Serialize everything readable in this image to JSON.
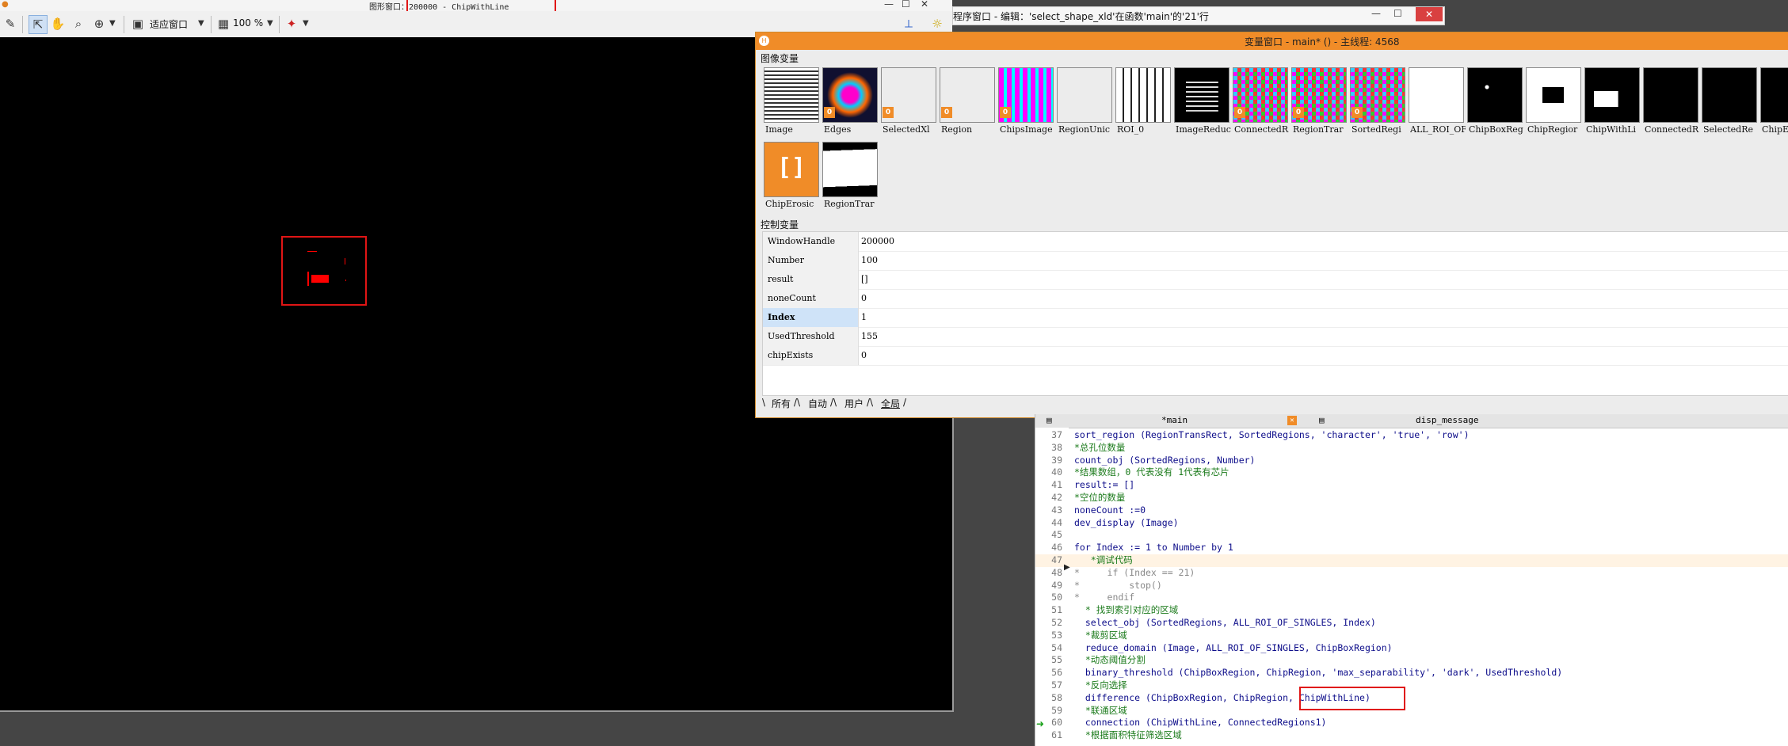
{
  "graphics_window": {
    "title": "图形窗口：200000 - ChipWithLine",
    "title_prefix": "图形窗口：",
    "title_value": "200000 - ChipWithLine",
    "toolbar": {
      "fit_label": "适应窗口",
      "zoom_label": "100 %"
    }
  },
  "editor_window": {
    "title": "程序窗口 - 编辑：'select_shape_xld'在函数'main'的'21'行"
  },
  "variable_window": {
    "title": "变量窗口 - main* () - 主线程: 4568",
    "iconic_section_label": "图像变量",
    "control_section_label": "控制变量",
    "iconic_variables": [
      {
        "name": "Image",
        "style": "chip",
        "badge": ""
      },
      {
        "name": "Edges",
        "style": "edges",
        "badge": "0"
      },
      {
        "name": "SelectedXl",
        "style": "grid-color",
        "badge": "0"
      },
      {
        "name": "Region",
        "style": "grid-color",
        "badge": "0"
      },
      {
        "name": "ChipsImage",
        "style": "grid-color2",
        "badge": "0"
      },
      {
        "name": "RegionUnic",
        "style": "grid-white",
        "badge": ""
      },
      {
        "name": "ROI_0",
        "style": "stripes",
        "badge": ""
      },
      {
        "name": "ImageReduc",
        "style": "chip-dark",
        "badge": ""
      },
      {
        "name": "ConnectedR",
        "style": "checker",
        "badge": "0"
      },
      {
        "name": "RegionTrar",
        "style": "checker",
        "badge": "0"
      },
      {
        "name": "SortedRegi",
        "style": "checker",
        "badge": "0"
      },
      {
        "name": "ALL_ROI_OF",
        "style": "white",
        "badge": ""
      },
      {
        "name": "ChipBoxReg",
        "style": "black-dot",
        "badge": ""
      },
      {
        "name": "ChipRegior",
        "style": "white-box",
        "badge": ""
      },
      {
        "name": "ChipWithLi",
        "style": "black-box",
        "badge": ""
      },
      {
        "name": "ConnectedR",
        "style": "black",
        "badge": ""
      },
      {
        "name": "SelectedRe",
        "style": "black",
        "badge": ""
      },
      {
        "name": "ChipE",
        "style": "black",
        "badge": ""
      },
      {
        "name": "ChipErosic",
        "style": "empty",
        "badge": ""
      },
      {
        "name": "RegionTrar",
        "style": "white-skew",
        "badge": ""
      }
    ],
    "empty_glyph": "[]",
    "control_variables": [
      {
        "name": "WindowHandle",
        "value": "200000"
      },
      {
        "name": "Number",
        "value": "100"
      },
      {
        "name": "result",
        "value": "[]"
      },
      {
        "name": "noneCount",
        "value": "0"
      },
      {
        "name": "Index",
        "value": "1"
      },
      {
        "name": "UsedThreshold",
        "value": "155"
      },
      {
        "name": "chipExists",
        "value": "0"
      }
    ],
    "tabs": [
      "所有",
      "自动",
      "用户",
      "全局"
    ]
  },
  "program_window": {
    "tabs": [
      "*main",
      "disp_message"
    ],
    "lines": [
      {
        "n": "37",
        "kind": "op",
        "text": "sort_region (RegionTransRect, SortedRegions, 'character', 'true', 'row')"
      },
      {
        "n": "38",
        "kind": "cm",
        "text": "*总孔位数量"
      },
      {
        "n": "39",
        "kind": "op",
        "text": "count_obj (SortedRegions, Number)"
      },
      {
        "n": "40",
        "kind": "cm",
        "text": "*结果数组，0 代表没有 1代表有芯片"
      },
      {
        "n": "41",
        "kind": "op",
        "text": "result:= []"
      },
      {
        "n": "42",
        "kind": "cm",
        "text": "*空位的数量"
      },
      {
        "n": "43",
        "kind": "op",
        "text": "noneCount :=0"
      },
      {
        "n": "44",
        "kind": "op",
        "text": "dev_display (Image)"
      },
      {
        "n": "45",
        "kind": "op",
        "text": ""
      },
      {
        "n": "46",
        "kind": "op",
        "text": "for Index := 1 to Number by 1"
      },
      {
        "n": "47",
        "kind": "cm",
        "text": "   *调试代码"
      },
      {
        "n": "48",
        "kind": "dis",
        "text": "*     if (Index == 21)"
      },
      {
        "n": "49",
        "kind": "dis",
        "text": "*         stop()"
      },
      {
        "n": "50",
        "kind": "dis",
        "text": "*     endif"
      },
      {
        "n": "51",
        "kind": "cm",
        "text": "  * 找到索引对应的区域"
      },
      {
        "n": "52",
        "kind": "op",
        "text": "  select_obj (SortedRegions, ALL_ROI_OF_SINGLES, Index)"
      },
      {
        "n": "53",
        "kind": "cm",
        "text": "  *裁剪区域"
      },
      {
        "n": "54",
        "kind": "op",
        "text": "  reduce_domain (Image, ALL_ROI_OF_SINGLES, ChipBoxRegion)"
      },
      {
        "n": "55",
        "kind": "cm",
        "text": "  *动态阈值分割"
      },
      {
        "n": "56",
        "kind": "op",
        "text": "  binary_threshold (ChipBoxRegion, ChipRegion, 'max_separability', 'dark', UsedThreshold)"
      },
      {
        "n": "57",
        "kind": "cm",
        "text": "  *反向选择"
      },
      {
        "n": "58",
        "kind": "op",
        "text": "  difference (ChipBoxRegion, ChipRegion, ChipWithLine)"
      },
      {
        "n": "59",
        "kind": "cm",
        "text": "  *联通区域"
      },
      {
        "n": "60",
        "kind": "op",
        "text": "  connection (ChipWithLine, ConnectedRegions1)"
      },
      {
        "n": "61",
        "kind": "cm",
        "text": "  *根据面积特征筛选区域"
      }
    ]
  },
  "colors": {
    "halcon_orange": "#f08c28",
    "highlight_red": "#e01515",
    "region_red": "#ff0000",
    "operator_blue": "#0d0d8a",
    "comment_green": "#1a7a1a"
  }
}
